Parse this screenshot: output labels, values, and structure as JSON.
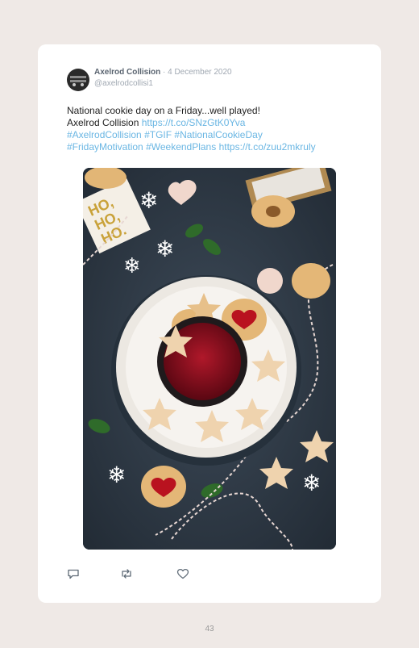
{
  "tweet": {
    "author_name": "Axelrod Collision",
    "separator": " · ",
    "date": "4 December 2020",
    "handle": "@axelrodcollisi1",
    "text_line1": "National cookie day on a Friday...well played!",
    "text_line2_plain": "Axelrod Collision ",
    "link_short": "https://t.co/SNzGtK0Yva",
    "hashtag1": "#AxelrodCollision",
    "hashtag2": "#TGIF",
    "hashtag3": "#NationalCookieDay",
    "hashtag4": "#FridayMotivation",
    "hashtag5": "#WeekendPlans",
    "link_short2": "https://t.co/zuu2mkruly",
    "photo_tag_text": [
      "HO,",
      "HO,",
      "HO."
    ]
  },
  "actions": [
    "reply-icon",
    "retweet-icon",
    "like-icon"
  ],
  "page_number": "43",
  "colors": {
    "page_bg": "#efe9e6",
    "card_bg": "#ffffff",
    "link": "#6ab6e3",
    "author": "#5a6470",
    "muted": "#a0a8b2"
  }
}
